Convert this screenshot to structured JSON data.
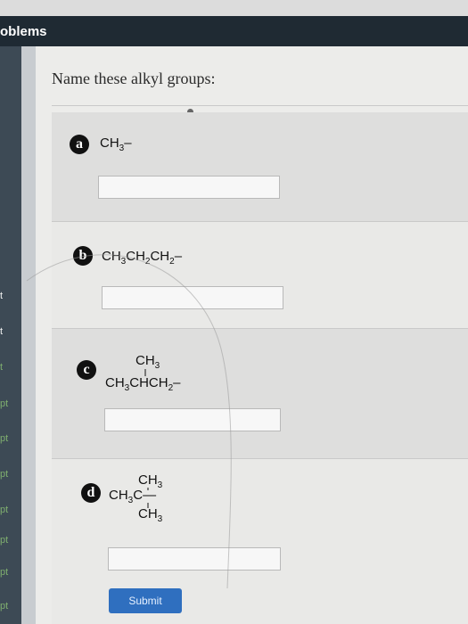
{
  "header": {
    "title": "oblems"
  },
  "sidebar": {
    "items": [
      "t",
      "t",
      "t",
      "pt",
      "pt",
      "pt",
      "pt",
      "pt",
      "pt",
      "pt"
    ]
  },
  "question": {
    "title": "Name these alkyl groups:"
  },
  "parts": [
    {
      "letter": "a",
      "formula_parts": [
        "CH",
        "3",
        "–"
      ]
    },
    {
      "letter": "b",
      "formula_parts": [
        "CH",
        "3",
        "CH",
        "2",
        "CH",
        "2",
        "–"
      ]
    },
    {
      "letter": "c",
      "top": "CH3",
      "main": [
        "CH",
        "3",
        "CHCH",
        "2",
        "–"
      ]
    },
    {
      "letter": "d",
      "top": "CH3",
      "main": [
        "CH",
        "3",
        "C—"
      ],
      "bottom": "CH3"
    }
  ],
  "submit": {
    "label": "Submit"
  }
}
